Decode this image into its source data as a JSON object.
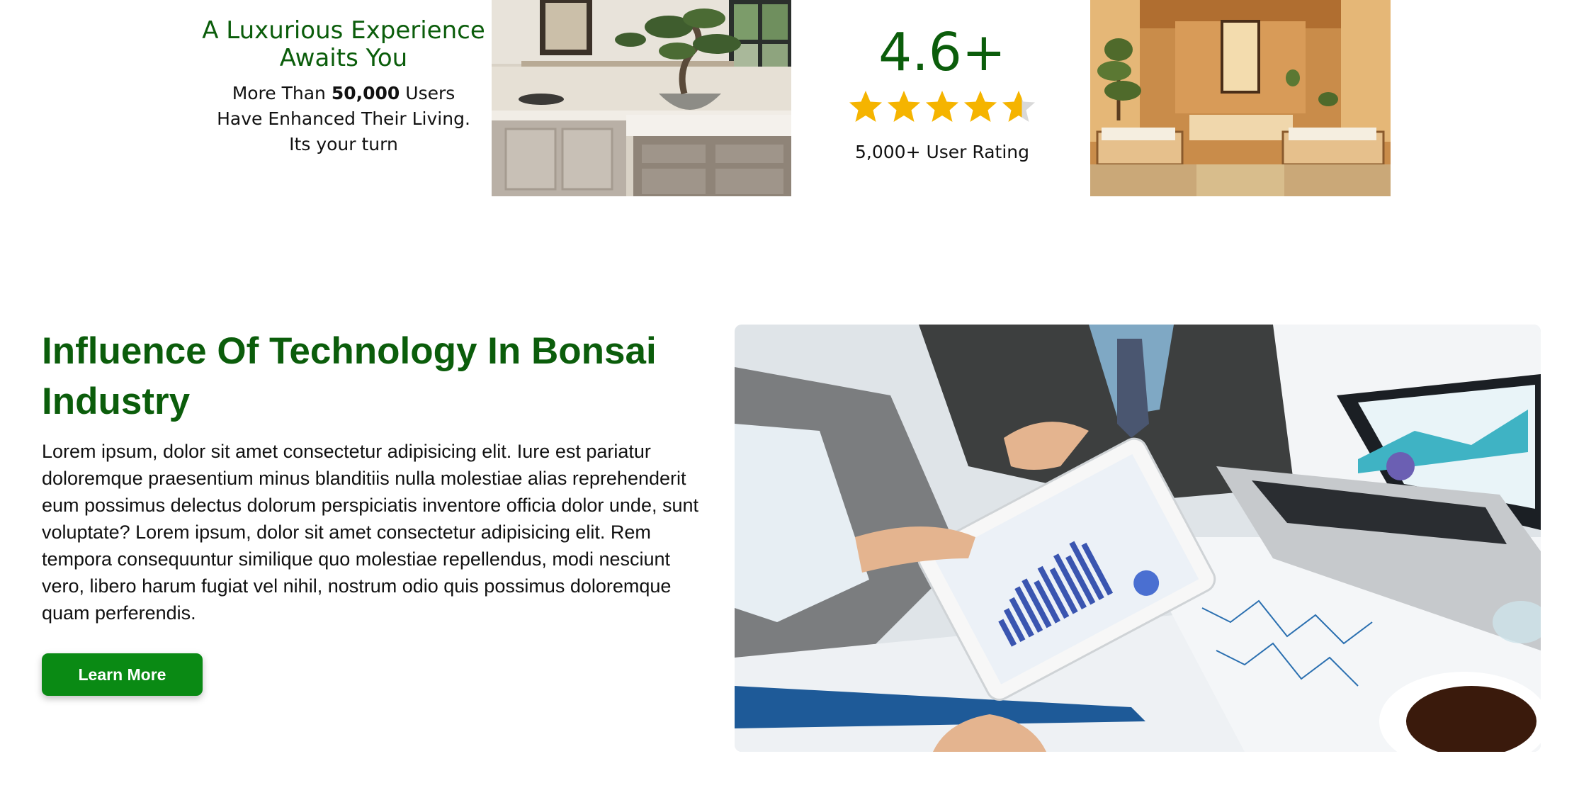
{
  "promo": {
    "title": "A Luxurious Experience Awaits You",
    "line1_prefix": "More Than ",
    "line1_bold": "50,000",
    "line1_suffix": " Users",
    "line2": "Have Enhanced Their Living.",
    "line3": "Its your turn"
  },
  "rating": {
    "value": "4.6+",
    "stars": 4.6,
    "max_stars": 5,
    "label": "5,000+ User Rating",
    "star_color": "#f5b400"
  },
  "feature": {
    "title": "Influence Of Technology In Bonsai Industry",
    "body": "Lorem ipsum, dolor sit amet consectetur adipisicing elit. Iure est pariatur doloremque praesentium minus blanditiis nulla molestiae alias reprehenderit eum possimus delectus dolorum perspiciatis inventore officia dolor unde, sunt voluptate? Lorem ipsum, dolor sit amet consectetur adipisicing elit. Rem tempora consequuntur similique quo molestiae repellendus, modi nesciunt vero, libero harum fugiat vel nihil, nostrum odio quis possimus doloremque quam perferendis.",
    "button_label": "Learn More"
  },
  "colors": {
    "brand_green": "#0b5d0b",
    "button_green": "#0a8a14"
  }
}
